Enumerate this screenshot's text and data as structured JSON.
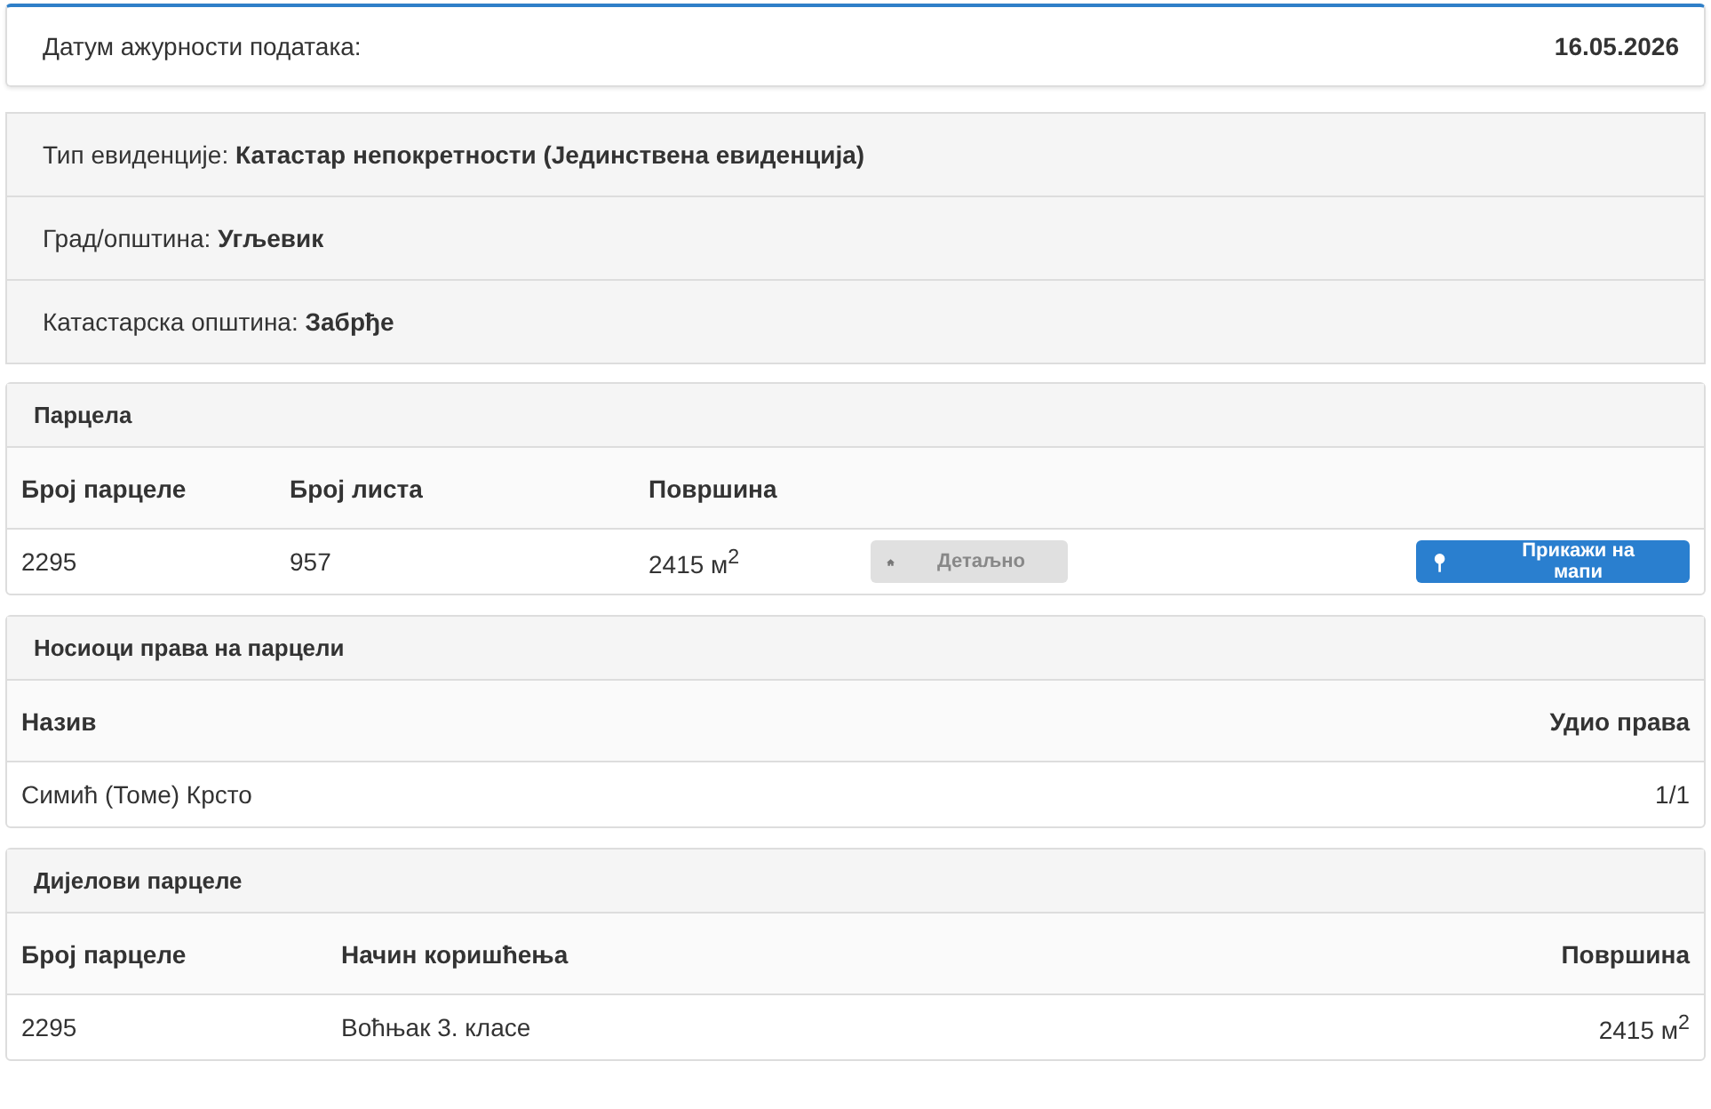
{
  "update": {
    "label": "Датум ажурности података:",
    "date": "16.05.2026"
  },
  "info": [
    {
      "label": "Тип евиденције:",
      "value": "Катастар непокретности (Јединствена евиденција)"
    },
    {
      "label": "Град/општина:",
      "value": "Угљевик"
    },
    {
      "label": "Катастарска општина:",
      "value": "Забрђе"
    }
  ],
  "parcel": {
    "title": "Парцела",
    "columns": [
      "Број парцеле",
      "Број листа",
      "Површина"
    ],
    "row": [
      "2295",
      "957",
      "2415 м$^{2}$"
    ],
    "detail_button": {
      "label": "Детаљно",
      "disabled": true
    },
    "map_button": {
      "label": "Прикажи на мапи",
      "disabled": false
    }
  },
  "owners": {
    "title": "Носиоци права на парцели",
    "columns": [
      "Назив",
      "Удио права"
    ],
    "rows": [
      [
        "Симић (Томе) Крсто",
        "1/1"
      ]
    ]
  },
  "parts": {
    "title": "Дијелови парцеле",
    "columns": [
      "Број парцеле",
      "Начин коришћења",
      "Површина"
    ],
    "rows": [
      [
        "2295",
        "Воћњак 3. класе",
        "2415 м$^{2}$"
      ]
    ]
  }
}
